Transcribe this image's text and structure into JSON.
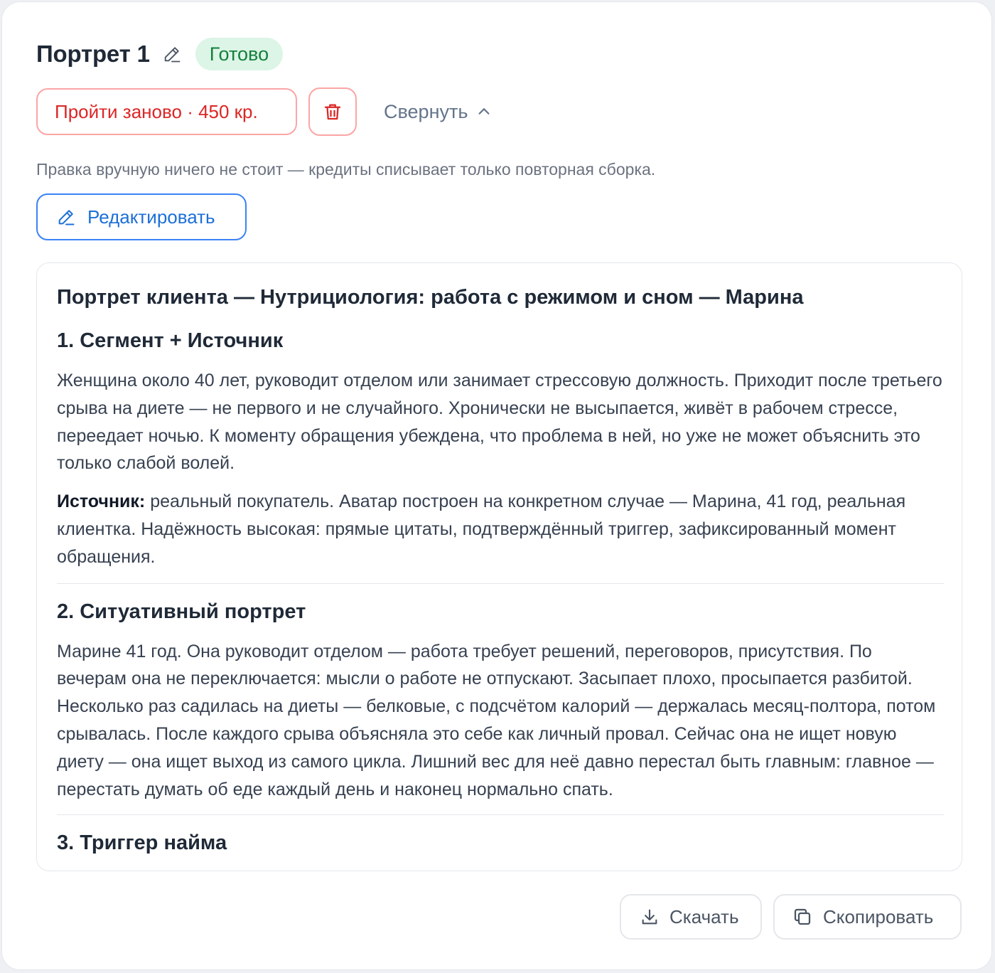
{
  "header": {
    "title": "Портрет 1",
    "status_badge": "Готово"
  },
  "actions": {
    "redo_label": "Пройти заново · 450 кр.",
    "collapse_label": "Свернуть",
    "note": "Правка вручную ничего не стоит — кредиты списывает только повторная сборка.",
    "edit_label": "Редактировать"
  },
  "document": {
    "title": "Портрет клиента — Нутрициология: работа с режимом и сном — Марина",
    "sections": [
      {
        "heading": "1. Сегмент + Источник",
        "paragraph": "Женщина около 40 лет, руководит отделом или занимает стрессовую должность. Приходит после третьего срыва на диете — не первого и не случайного. Хронически не высыпается, живёт в рабочем стрессе, переедает ночью. К моменту обращения убеждена, что проблема в ней, но уже не может объяснить это только слабой волей.",
        "source_label": "Источник:",
        "source_text": " реальный покупатель. Аватар построен на конкретном случае — Марина, 41 год, реальная клиентка. Надёжность высокая: прямые цитаты, подтверждённый триггер, зафиксированный момент обращения."
      },
      {
        "heading": "2. Ситуативный портрет",
        "paragraph": "Марине 41 год. Она руководит отделом — работа требует решений, переговоров, присутствия. По вечерам она не переключается: мысли о работе не отпускают. Засыпает плохо, просыпается разбитой. Несколько раз садилась на диеты — белковые, с подсчётом калорий — держалась месяц-полтора, потом срывалась. После каждого срыва объясняла это себе как личный провал. Сейчас она не ищет новую диету — она ищет выход из самого цикла. Лишний вес для неё давно перестал быть главным: главное — перестать думать об еде каждый день и наконец нормально спать."
      },
      {
        "heading": "3. Триггер найма"
      }
    ]
  },
  "footer": {
    "download_label": "Скачать",
    "copy_label": "Скопировать"
  },
  "colors": {
    "accent_blue": "#1d6fd8",
    "danger_red": "#dc2626",
    "success_green": "#15803d"
  },
  "icons": [
    "pencil-icon",
    "trash-icon",
    "chevron-up-icon",
    "download-icon",
    "copy-icon"
  ]
}
